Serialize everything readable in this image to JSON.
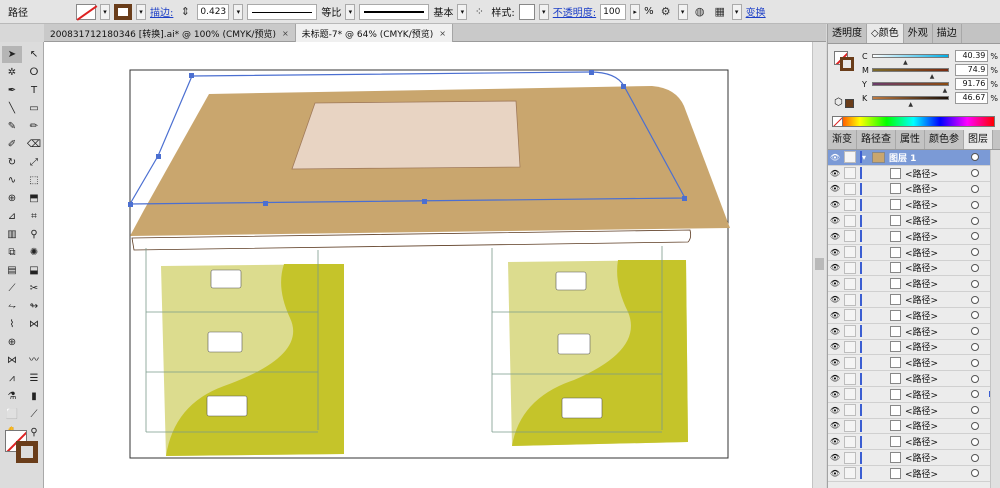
{
  "control_bar": {
    "object_label": "路径",
    "stroke_label": "描边:",
    "stroke_weight": "0.423",
    "profile_label": "等比",
    "brush_label": "基本",
    "style_label": "样式:",
    "opacity_label": "不透明度:",
    "opacity_value": "100",
    "opacity_unit": "%",
    "transform_label": "变换"
  },
  "tabs": [
    {
      "label": "200831712180346  [转换].ai* @ 100% (CMYK/预览)",
      "close": "×"
    },
    {
      "label": "未标题-7* @ 64% (CMYK/预览)",
      "close": "×"
    }
  ],
  "color_panel": {
    "tabs": [
      "透明度",
      "◇颜色",
      "外观",
      "描边"
    ],
    "channels": [
      {
        "name": "C",
        "value": "40.39",
        "pos": 0.4
      },
      {
        "name": "M",
        "value": "74.9",
        "pos": 0.75
      },
      {
        "name": "Y",
        "value": "91.76",
        "pos": 0.92
      },
      {
        "name": "K",
        "value": "46.67",
        "pos": 0.47
      }
    ],
    "percent": "%",
    "stroke_color": "#6a3d1a"
  },
  "layers_panel": {
    "tabs": [
      "渐变",
      "路径查",
      "属性",
      "颜色参",
      "图层"
    ],
    "layer_name": "图层 1",
    "item_label": "<路径>",
    "item_count": 20
  },
  "colors": {
    "desk_top": "#c9a66e",
    "desk_pad": "#e8d4c3",
    "cabinet_light": "#dcdc8e",
    "cabinet_dark": "#c5c42a",
    "selection": "#4b6fd1"
  }
}
